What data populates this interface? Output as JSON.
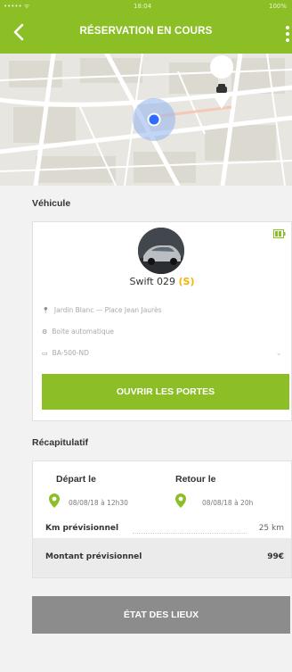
{
  "status_bar": {
    "carrier": "••••• ᯤ",
    "time": "18:04",
    "battery": "100%"
  },
  "header": {
    "title": "RÉSERVATION EN COURS"
  },
  "colors": {
    "accent": "#8cbf26",
    "badge": "#f5b400",
    "button_gray": "#8c8c8c"
  },
  "vehicle": {
    "section_title": "Véhicule",
    "name": "Swift 029",
    "badge": "(S)",
    "battery_icon": "battery-icon",
    "address": "Jardin Blanc — Place Jean Jaurès",
    "transmission": "Boite automatique",
    "plate": "BA-500-ND",
    "open_doors_label": "OUVRIR LES PORTES"
  },
  "recap": {
    "section_title": "Récapitulatif",
    "departure_label": "Départ le",
    "departure_date": "08/08/18 à 12h30",
    "return_label": "Retour le",
    "return_date": "08/08/18 à 20h",
    "km_label": "Km prévisionnel",
    "km_value": "25 km",
    "amount_label": "Montant prévisionnel",
    "amount_value": "99€"
  },
  "etat_button_label": "ÉTAT DES LIEUX"
}
